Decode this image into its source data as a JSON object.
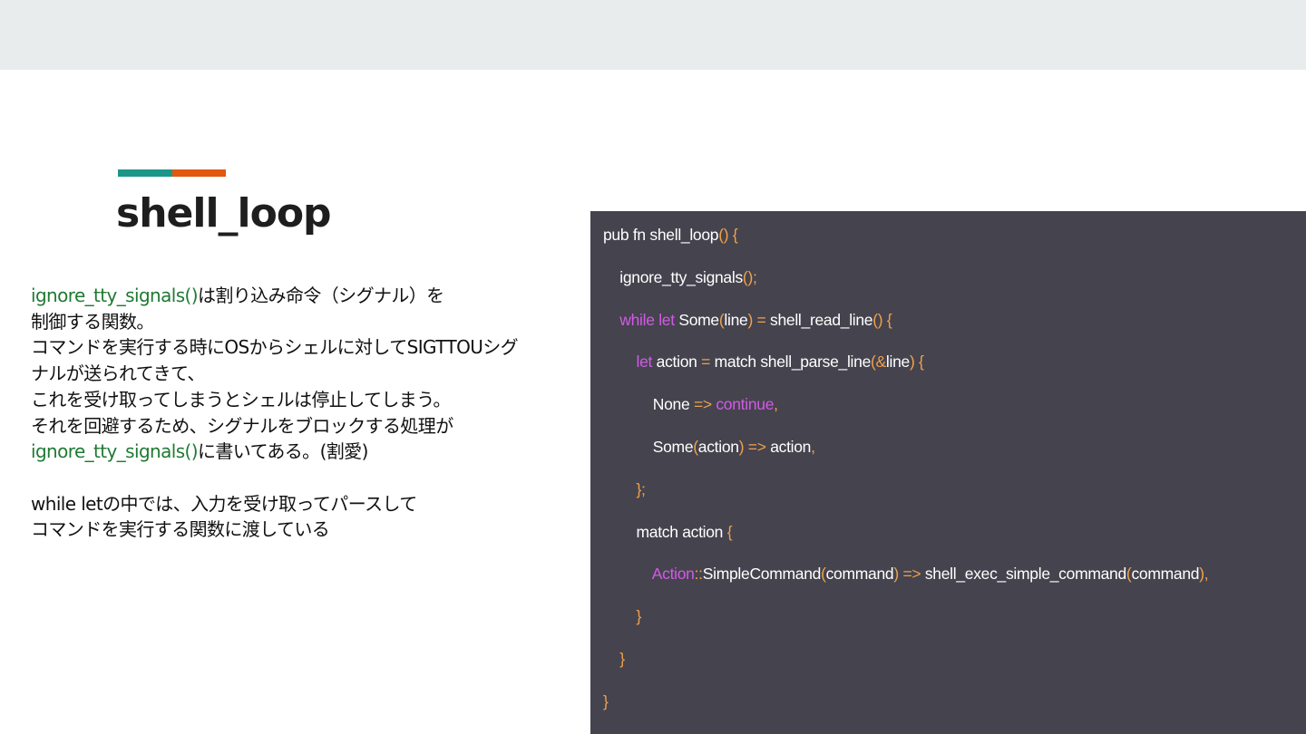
{
  "slide": {
    "title": "shell_loop",
    "colors": {
      "top_bar": "#e8ecec",
      "accent_left": "#1b9688",
      "accent_right": "#e0590d",
      "function_text": "#1f7a33",
      "code_background": "#45434e",
      "code_keyword": "#d25ae6",
      "code_operator": "#f0a14a"
    },
    "description": {
      "line1_fn": "ignore_tty_signals()",
      "line1_rest": "は割り込み命令（シグナル）を",
      "line2": "制御する関数。",
      "line3": "コマンドを実行する時にOSからシェルに対してSIGTTOUシグ",
      "line4": "ナルが送られてきて、",
      "line5": "これを受け取ってしまうとシェルは停止してしまう。",
      "line6": "それを回避するため、シグナルをブロックする処理が",
      "line7_fn": "ignore_tty_signals()",
      "line7_rest": "に書いてある。(割愛)",
      "line9": "while letの中では、入力を受け取ってパースして",
      "line10": "コマンドを実行する関数に渡している"
    },
    "code_tokens": {
      "l1_a": "pub fn shell_loop",
      "l1_b": "() {",
      "l2_a": "    ignore_tty_signals",
      "l2_b": "();",
      "l3_a": "    while let",
      "l3_b": " Some",
      "l3_c": "(",
      "l3_d": "line",
      "l3_e": ") = ",
      "l3_f": "shell_read_line",
      "l3_g": "() {",
      "l4_a": "        let",
      "l4_b": " action ",
      "l4_c": "=",
      "l4_d": " match shell_parse_line",
      "l4_e": "(&",
      "l4_f": "line",
      "l4_g": ") {",
      "l5_a": "            None ",
      "l5_b": "=>",
      "l5_c": " continue",
      "l5_d": ",",
      "l6_a": "            Some",
      "l6_b": "(",
      "l6_c": "action",
      "l6_d": ") =>",
      "l6_e": " action",
      "l6_f": ",",
      "l7_a": "        };",
      "l8_a": "        match action ",
      "l8_b": "{",
      "l9_a": "            Action",
      "l9_b": "::",
      "l9_c": "SimpleCommand",
      "l9_d": "(",
      "l9_e": "command",
      "l9_f": ") =>",
      "l9_g": " shell_exec_simple_command",
      "l9_h": "(",
      "l9_i": "command",
      "l9_j": "),",
      "l10_a": "        }",
      "l11_a": "    }",
      "l12_a": "}"
    }
  }
}
